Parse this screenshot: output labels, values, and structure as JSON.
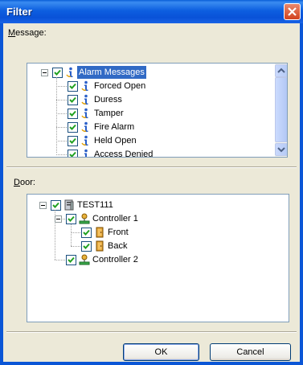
{
  "window": {
    "title": "Filter"
  },
  "message": {
    "label_prefix": "M",
    "label_rest": "essage:",
    "root": {
      "label": "Alarm Messages",
      "checked": true,
      "selected": true
    },
    "items": [
      {
        "label": "Forced Open",
        "checked": true
      },
      {
        "label": "Duress",
        "checked": true
      },
      {
        "label": "Tamper",
        "checked": true
      },
      {
        "label": "Fire Alarm",
        "checked": true
      },
      {
        "label": "Held Open",
        "checked": true
      },
      {
        "label": "Access Denied",
        "checked": true
      }
    ],
    "icon": "info-icon"
  },
  "door": {
    "label_prefix": "D",
    "label_rest": "oor:",
    "root": {
      "label": "TEST111",
      "checked": true,
      "icon": "server-icon"
    },
    "controllers": [
      {
        "label": "Controller 1",
        "checked": true,
        "icon": "network-node-icon",
        "doors": [
          {
            "label": "Front",
            "checked": true,
            "icon": "door-icon"
          },
          {
            "label": "Back",
            "checked": true,
            "icon": "door-icon"
          }
        ]
      },
      {
        "label": "Controller 2",
        "checked": true,
        "icon": "network-node-icon",
        "doors": []
      }
    ]
  },
  "buttons": {
    "ok": "OK",
    "cancel": "Cancel"
  },
  "colors": {
    "title_bar": "#0a5fd8",
    "dialog_bg": "#ece9d8",
    "selection": "#316ac5",
    "check": "#21a121"
  }
}
